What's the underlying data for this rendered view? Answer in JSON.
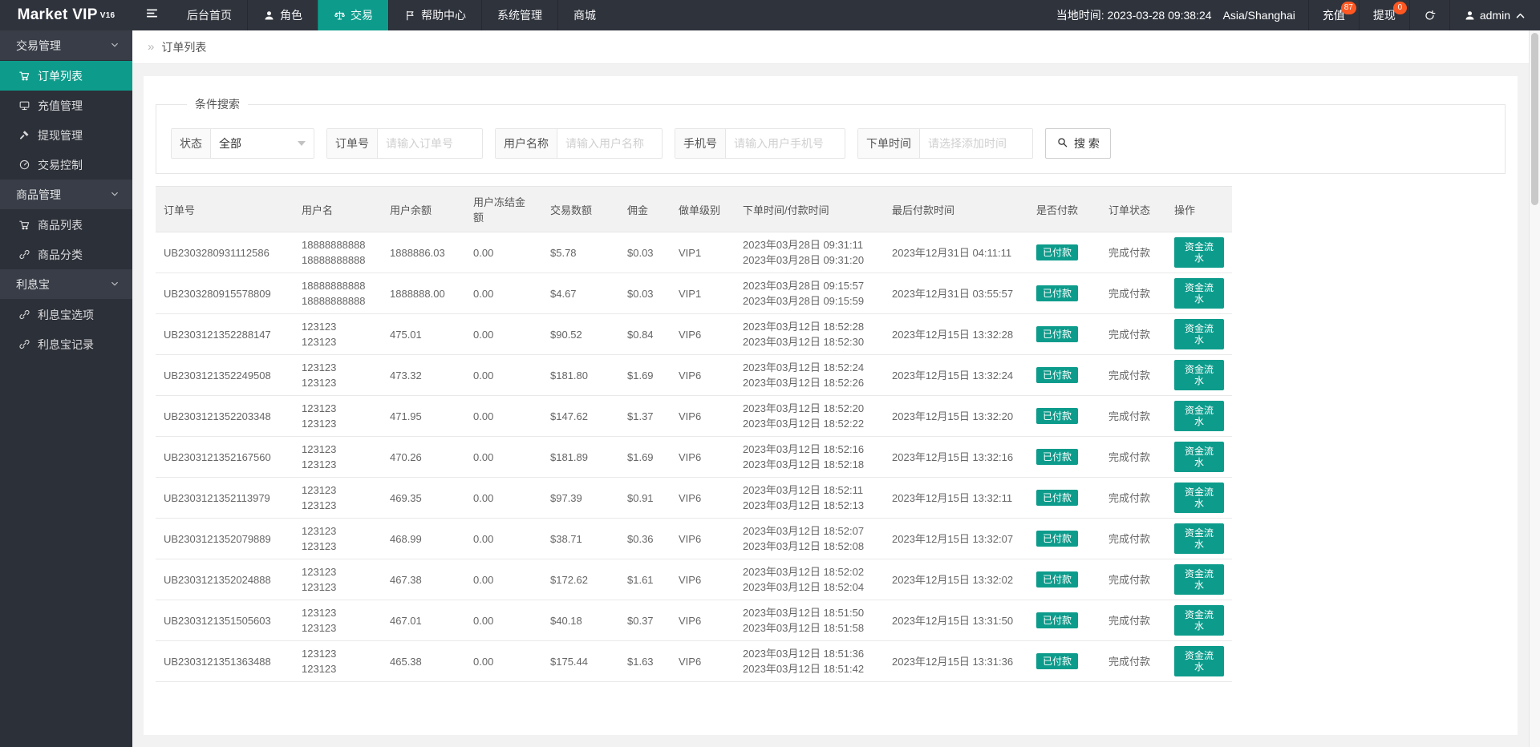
{
  "header": {
    "logo": "Market VIP",
    "logo_sup": "V16",
    "nav": [
      {
        "label": "后台首页"
      },
      {
        "label": "角色"
      },
      {
        "label": "交易"
      },
      {
        "label": "帮助中心"
      },
      {
        "label": "系统管理"
      },
      {
        "label": "商城"
      }
    ],
    "local_time": "当地时间: 2023-03-28 09:38:24",
    "timezone": "Asia/Shanghai",
    "recharge": {
      "label": "充值",
      "badge": "87"
    },
    "withdraw": {
      "label": "提现",
      "badge": "0"
    },
    "user": "admin"
  },
  "sidebar": {
    "items": [
      {
        "label": "交易管理"
      },
      {
        "label": "订单列表"
      },
      {
        "label": "充值管理"
      },
      {
        "label": "提现管理"
      },
      {
        "label": "交易控制"
      },
      {
        "label": "商品管理"
      },
      {
        "label": "商品列表"
      },
      {
        "label": "商品分类"
      },
      {
        "label": "利息宝"
      },
      {
        "label": "利息宝选项"
      },
      {
        "label": "利息宝记录"
      }
    ]
  },
  "breadcrumb": {
    "icon": "»",
    "title": "订单列表"
  },
  "filters": {
    "legend": "条件搜索",
    "status": {
      "label": "状态",
      "value": "全部"
    },
    "order_no": {
      "label": "订单号",
      "placeholder": "请输入订单号"
    },
    "username": {
      "label": "用户名称",
      "placeholder": "请输入用户名称"
    },
    "phone": {
      "label": "手机号",
      "placeholder": "请输入用户手机号"
    },
    "order_time": {
      "label": "下单时间",
      "placeholder": "请选择添加时间"
    },
    "search_label": "搜 索"
  },
  "table": {
    "columns": [
      "订单号",
      "用户名",
      "用户余额",
      "用户冻结金额",
      "交易数额",
      "佣金",
      "做单级别",
      "下单时间/付款时间",
      "最后付款时间",
      "是否付款",
      "订单状态",
      "操作"
    ],
    "pay_badge": "已付款",
    "status_text": "完成付款",
    "action_label": "资金流水",
    "rows": [
      {
        "order_no": "UB2303280931112586",
        "user1": "18888888888",
        "user2": "18888888888",
        "balance": "1888886.03",
        "frozen": "0.00",
        "amount": "$5.78",
        "commission": "$0.03",
        "level": "VIP1",
        "time1": "2023年03月28日 09:31:11",
        "time2": "2023年03月28日 09:31:20",
        "last_pay": "2023年12月31日 04:11:11"
      },
      {
        "order_no": "UB2303280915578809",
        "user1": "18888888888",
        "user2": "18888888888",
        "balance": "1888888.00",
        "frozen": "0.00",
        "amount": "$4.67",
        "commission": "$0.03",
        "level": "VIP1",
        "time1": "2023年03月28日 09:15:57",
        "time2": "2023年03月28日 09:15:59",
        "last_pay": "2023年12月31日 03:55:57"
      },
      {
        "order_no": "UB2303121352288147",
        "user1": "123123",
        "user2": "123123",
        "balance": "475.01",
        "frozen": "0.00",
        "amount": "$90.52",
        "commission": "$0.84",
        "level": "VIP6",
        "time1": "2023年03月12日 18:52:28",
        "time2": "2023年03月12日 18:52:30",
        "last_pay": "2023年12月15日 13:32:28"
      },
      {
        "order_no": "UB2303121352249508",
        "user1": "123123",
        "user2": "123123",
        "balance": "473.32",
        "frozen": "0.00",
        "amount": "$181.80",
        "commission": "$1.69",
        "level": "VIP6",
        "time1": "2023年03月12日 18:52:24",
        "time2": "2023年03月12日 18:52:26",
        "last_pay": "2023年12月15日 13:32:24"
      },
      {
        "order_no": "UB2303121352203348",
        "user1": "123123",
        "user2": "123123",
        "balance": "471.95",
        "frozen": "0.00",
        "amount": "$147.62",
        "commission": "$1.37",
        "level": "VIP6",
        "time1": "2023年03月12日 18:52:20",
        "time2": "2023年03月12日 18:52:22",
        "last_pay": "2023年12月15日 13:32:20"
      },
      {
        "order_no": "UB2303121352167560",
        "user1": "123123",
        "user2": "123123",
        "balance": "470.26",
        "frozen": "0.00",
        "amount": "$181.89",
        "commission": "$1.69",
        "level": "VIP6",
        "time1": "2023年03月12日 18:52:16",
        "time2": "2023年03月12日 18:52:18",
        "last_pay": "2023年12月15日 13:32:16"
      },
      {
        "order_no": "UB2303121352113979",
        "user1": "123123",
        "user2": "123123",
        "balance": "469.35",
        "frozen": "0.00",
        "amount": "$97.39",
        "commission": "$0.91",
        "level": "VIP6",
        "time1": "2023年03月12日 18:52:11",
        "time2": "2023年03月12日 18:52:13",
        "last_pay": "2023年12月15日 13:32:11"
      },
      {
        "order_no": "UB2303121352079889",
        "user1": "123123",
        "user2": "123123",
        "balance": "468.99",
        "frozen": "0.00",
        "amount": "$38.71",
        "commission": "$0.36",
        "level": "VIP6",
        "time1": "2023年03月12日 18:52:07",
        "time2": "2023年03月12日 18:52:08",
        "last_pay": "2023年12月15日 13:32:07"
      },
      {
        "order_no": "UB2303121352024888",
        "user1": "123123",
        "user2": "123123",
        "balance": "467.38",
        "frozen": "0.00",
        "amount": "$172.62",
        "commission": "$1.61",
        "level": "VIP6",
        "time1": "2023年03月12日 18:52:02",
        "time2": "2023年03月12日 18:52:04",
        "last_pay": "2023年12月15日 13:32:02"
      },
      {
        "order_no": "UB2303121351505603",
        "user1": "123123",
        "user2": "123123",
        "balance": "467.01",
        "frozen": "0.00",
        "amount": "$40.18",
        "commission": "$0.37",
        "level": "VIP6",
        "time1": "2023年03月12日 18:51:50",
        "time2": "2023年03月12日 18:51:58",
        "last_pay": "2023年12月15日 13:31:50"
      },
      {
        "order_no": "UB2303121351363488",
        "user1": "123123",
        "user2": "123123",
        "balance": "465.38",
        "frozen": "0.00",
        "amount": "$175.44",
        "commission": "$1.63",
        "level": "VIP6",
        "time1": "2023年03月12日 18:51:36",
        "time2": "2023年03月12日 18:51:42",
        "last_pay": "2023年12月15日 13:31:36"
      }
    ]
  },
  "colors": {
    "accent_teal": "#0d9c8c",
    "badge_orange": "#ff5722",
    "dark_chrome": "#2f333c"
  }
}
